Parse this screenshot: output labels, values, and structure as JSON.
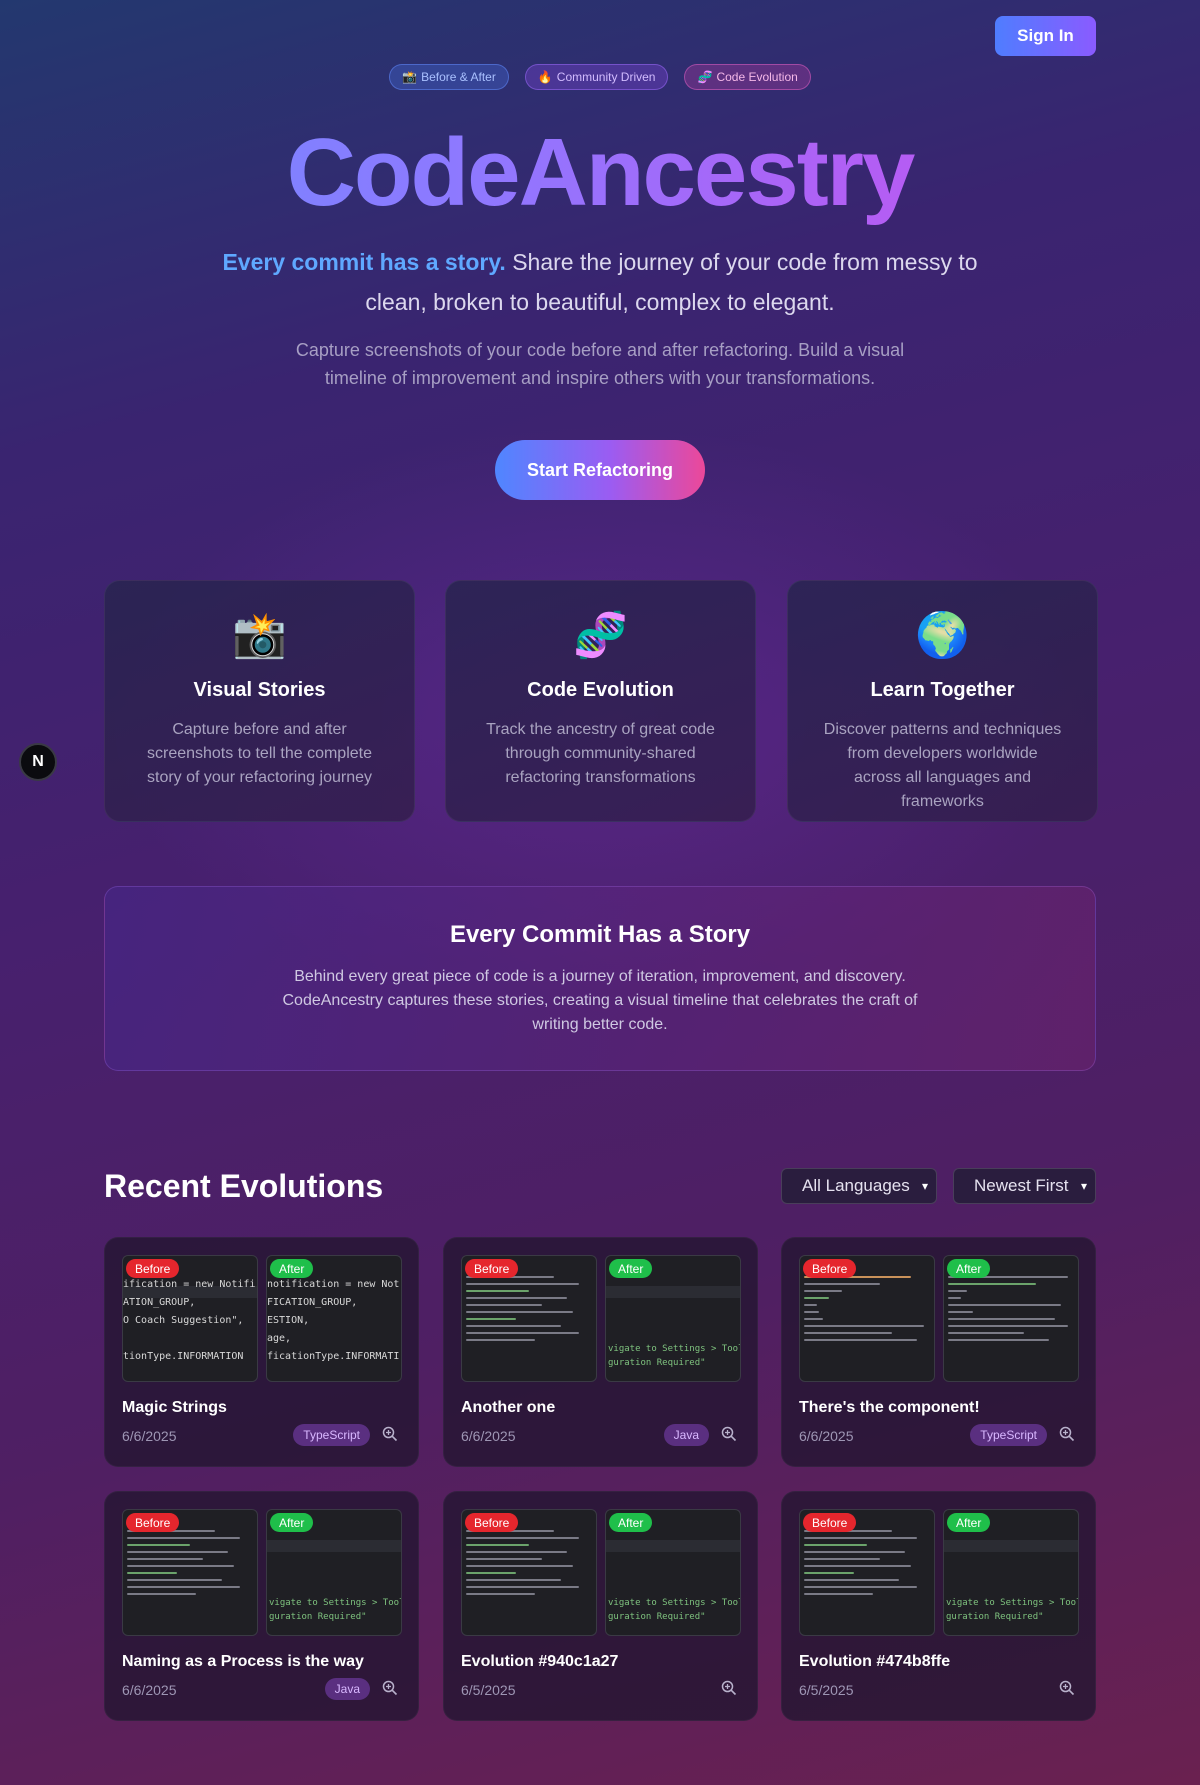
{
  "header": {
    "sign_in_label": "Sign In"
  },
  "badges": [
    {
      "icon": "📸",
      "label": "Before & After"
    },
    {
      "icon": "🔥",
      "label": "Community Driven"
    },
    {
      "icon": "🧬",
      "label": "Code Evolution"
    }
  ],
  "hero": {
    "title": "CodeAncestry",
    "tagline_highlight": "Every commit has a story.",
    "tagline_rest": " Share the journey of your code from messy to clean, broken to beautiful, complex to elegant.",
    "subtitle": "Capture screenshots of your code before and after refactoring. Build a visual timeline of improvement and inspire others with your transformations.",
    "cta_label": "Start Refactoring"
  },
  "features": [
    {
      "icon": "📸",
      "title": "Visual Stories",
      "desc": "Capture before and after screenshots to tell the complete story of your refactoring journey"
    },
    {
      "icon": "🧬",
      "title": "Code Evolution",
      "desc": "Track the ancestry of great code through community-shared refactoring transformations"
    },
    {
      "icon": "🌍",
      "title": "Learn Together",
      "desc": "Discover patterns and techniques from developers worldwide across all languages and frameworks"
    }
  ],
  "notification_badge": "N",
  "story": {
    "title": "Every Commit Has a Story",
    "desc": "Behind every great piece of code is a journey of iteration, improvement, and discovery. CodeAncestry captures these stories, creating a visual timeline that celebrates the craft of writing better code."
  },
  "recent": {
    "title": "Recent Evolutions",
    "language_filter": "All Languages",
    "sort_filter": "Newest First",
    "before_label": "Before",
    "after_label": "After",
    "cards": [
      {
        "title": "Magic Strings",
        "date": "6/6/2025",
        "language": "TypeScript"
      },
      {
        "title": "Another one",
        "date": "6/6/2025",
        "language": "Java"
      },
      {
        "title": "There's the component!",
        "date": "6/6/2025",
        "language": "TypeScript"
      },
      {
        "title": "Naming as a Process is the way",
        "date": "6/6/2025",
        "language": "Java"
      },
      {
        "title": "Evolution #940c1a27",
        "date": "6/5/2025",
        "language": ""
      },
      {
        "title": "Evolution #474b8ffe",
        "date": "6/5/2025",
        "language": ""
      }
    ],
    "card1_before_code": "ification = new Notifi\nATION_GROUP,\nO Coach Suggestion\",\n\ntionType.INFORMATION",
    "card1_after_code": "notification = new Not\nFICATION_GROUP,\nESTION,\nage,\nficationType.INFORMATI",
    "after_snippet": "vigate to Settings > Tools >\nguration Required\""
  }
}
